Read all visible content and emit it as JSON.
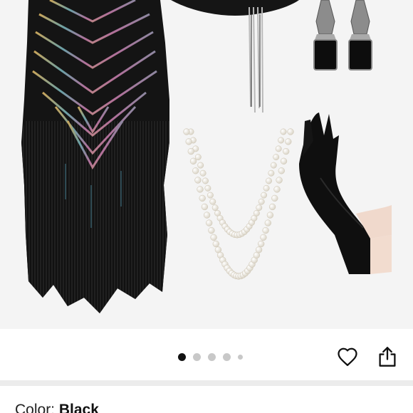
{
  "gallery": {
    "dots": [
      {
        "active": true,
        "size": "normal"
      },
      {
        "active": false,
        "size": "normal"
      },
      {
        "active": false,
        "size": "normal"
      },
      {
        "active": false,
        "size": "normal"
      },
      {
        "active": false,
        "size": "small"
      }
    ],
    "icons": {
      "favorite": "heart-icon",
      "share": "share-icon"
    }
  },
  "product": {
    "color_label": "Color: ",
    "color_value": "Black"
  },
  "colors": {
    "background": "#f4f4f4",
    "dot_active": "#111111",
    "dot_inactive": "#c8c8c8"
  }
}
